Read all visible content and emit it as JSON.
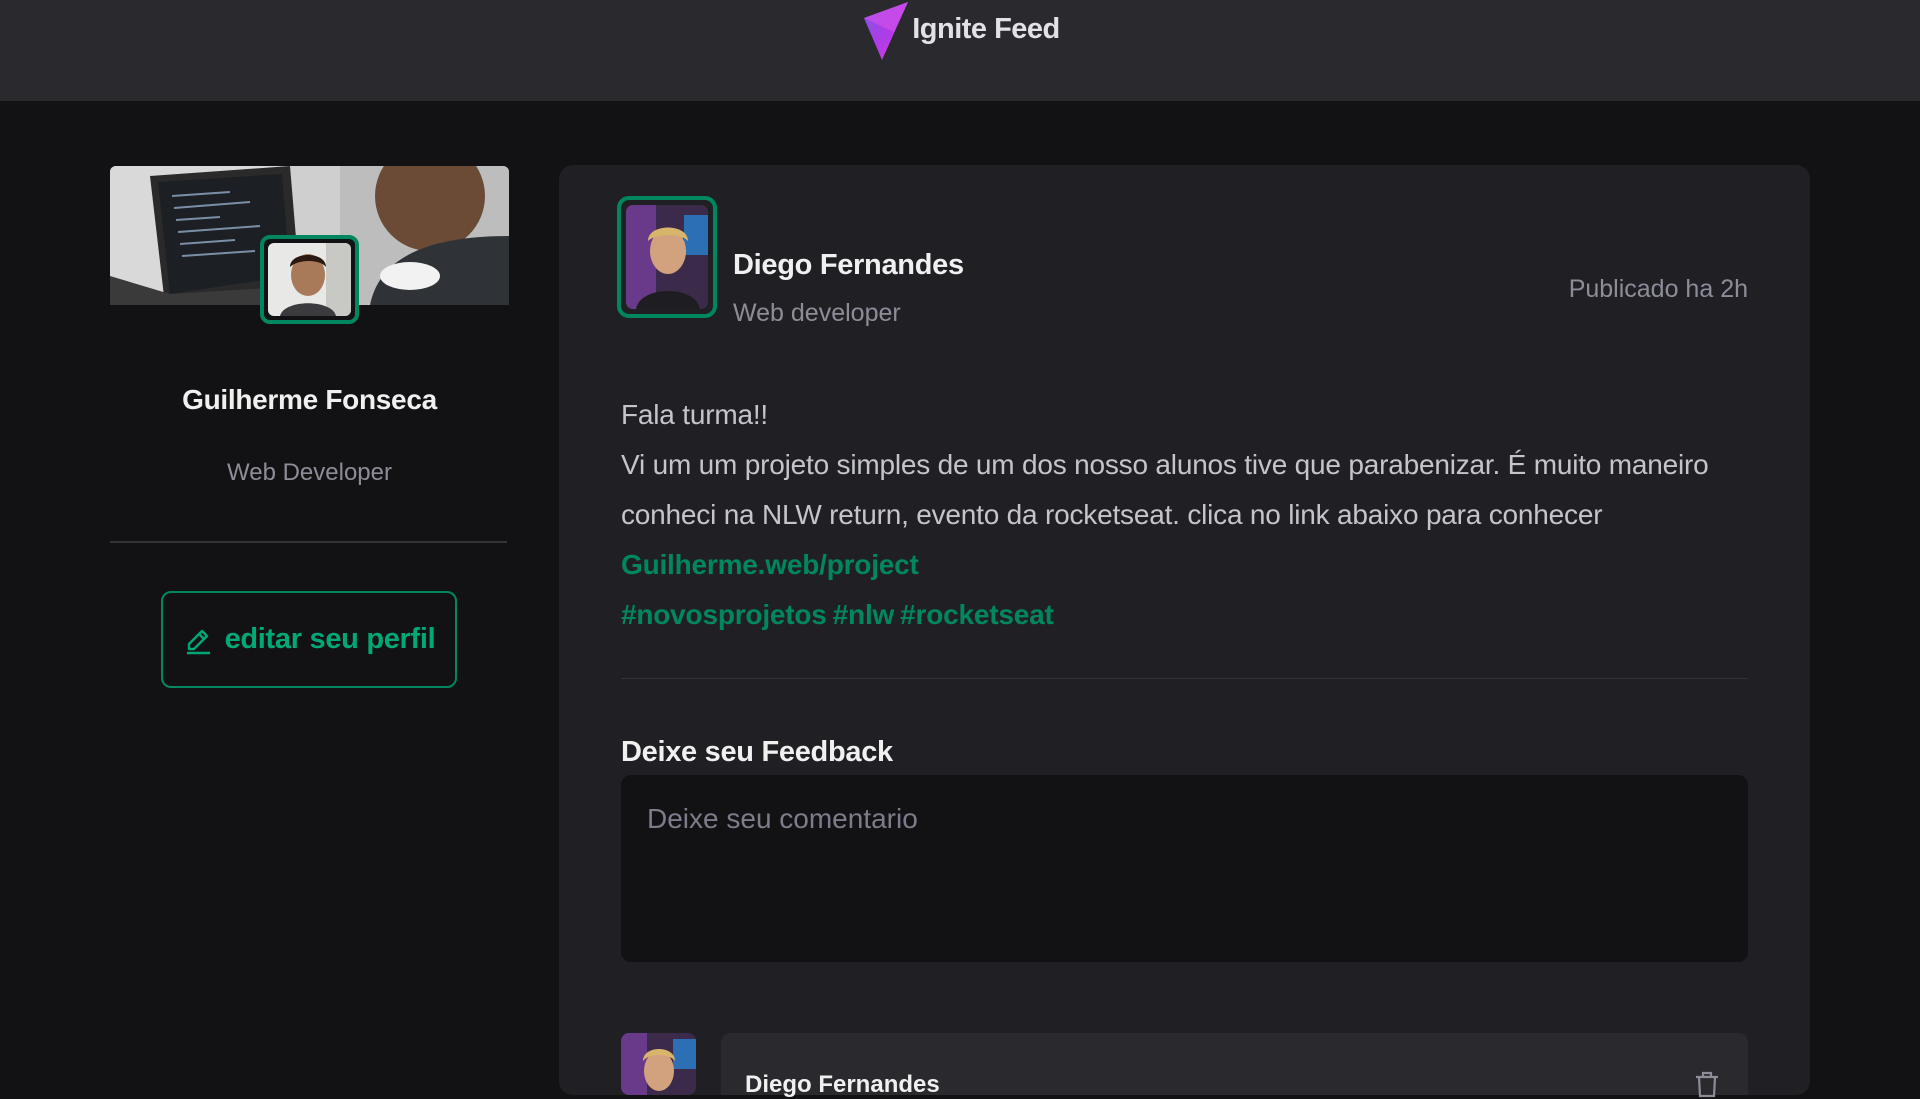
{
  "header": {
    "title": "Ignite Feed",
    "logo_icon": "ignite-triangle-logo"
  },
  "sidebar": {
    "name": "Guilherme Fonseca",
    "role": "Web Developer",
    "edit_button_label": "editar seu perfil",
    "edit_icon": "pencil-icon"
  },
  "post": {
    "author_name": "Diego Fernandes",
    "author_role": "Web developer",
    "published": "Publicado ha 2h",
    "content": {
      "greeting": "Fala turma!!",
      "body": "Vi um um projeto simples de um dos nosso alunos tive que parabenizar. É muito maneiro conheci na NLW return, evento da rocketseat. clica no link abaixo para conhecer",
      "link": "Guilherme.web/project",
      "hashtags": [
        "#novosprojetos",
        "#nlw",
        "#rocketseat"
      ]
    },
    "feedback_title": "Deixe seu Feedback",
    "comment_placeholder": "Deixe seu comentario",
    "comment_preview_author": "Diego Fernandes"
  },
  "colors": {
    "background": "#121214",
    "header": "#29292e",
    "card": "#202024",
    "accent": "#00875f",
    "text_muted": "#8d8d99"
  }
}
